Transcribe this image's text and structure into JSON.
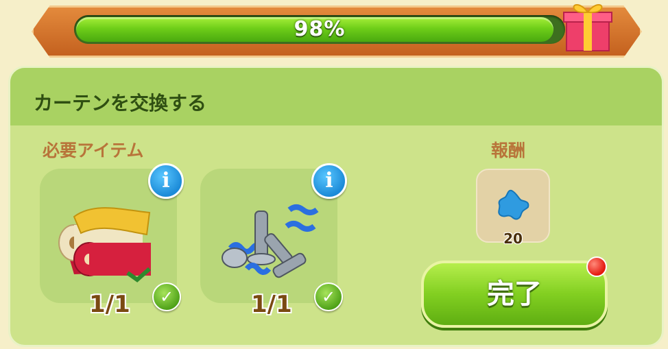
{
  "progress": {
    "label": "98%",
    "value": 0.98
  },
  "task": {
    "title": "カーテンを交換する"
  },
  "required": {
    "label": "必要アイテム",
    "items": [
      {
        "icon": "fabric-rolls-icon",
        "count": "1/1",
        "complete": true
      },
      {
        "icon": "bolts-springs-icon",
        "count": "1/1",
        "complete": true
      }
    ]
  },
  "reward": {
    "label": "報酬",
    "icon": "blue-star-icon",
    "amount": "20"
  },
  "actions": {
    "done_label": "完了"
  },
  "icons": {
    "info": "i",
    "check": "✓"
  },
  "colors": {
    "accent_green": "#82cf21",
    "banner_orange": "#c4611f",
    "info_blue": "#1c8bd8"
  }
}
